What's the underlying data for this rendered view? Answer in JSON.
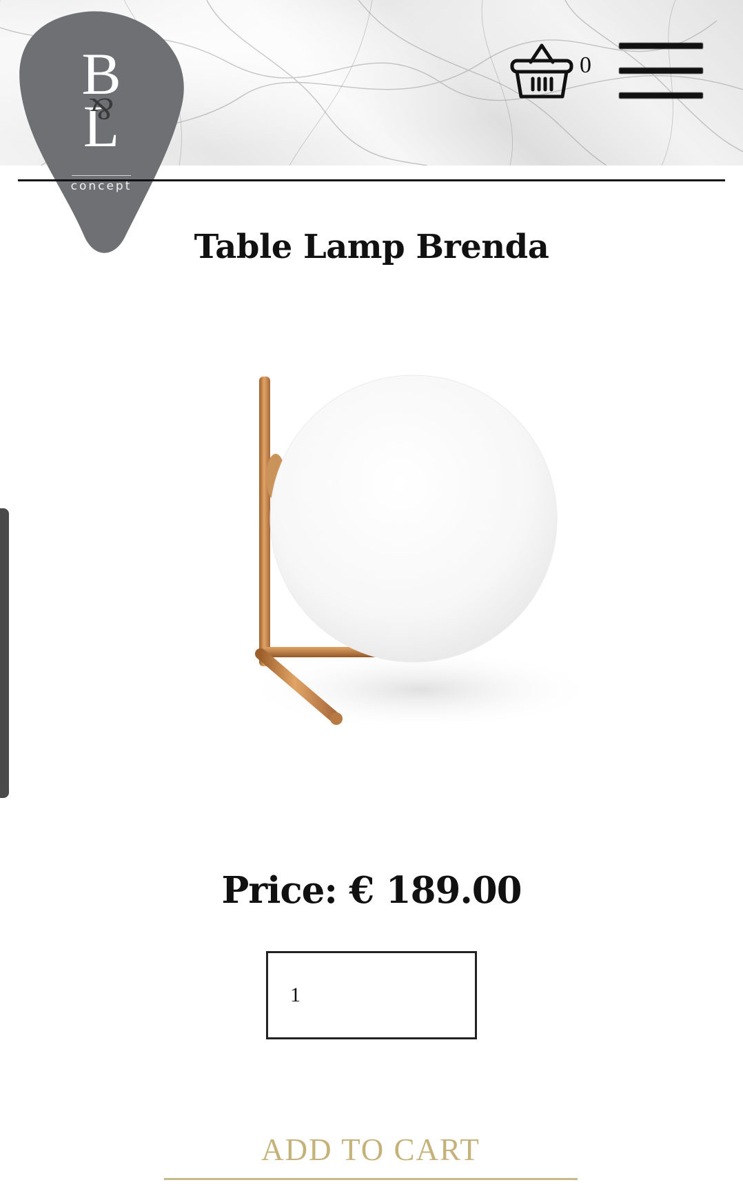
{
  "header": {
    "logo": {
      "letters": [
        "B",
        "L"
      ],
      "amp": "&",
      "subtitle": "concept",
      "color": "#6e7074"
    },
    "cart": {
      "icon": "basket-icon",
      "count": "0"
    },
    "menu": {
      "icon": "hamburger-menu-icon"
    }
  },
  "product": {
    "title": "Table Lamp Brenda",
    "image": "lamp-image",
    "price_label": "Price:",
    "price_value": "€ 189.00",
    "quantity": "1"
  },
  "actions": {
    "add_to_cart": "ADD TO CART"
  },
  "colors": {
    "accent_gold": "#c5b27a",
    "text": "#111111",
    "logo_grey": "#6e7074",
    "brass": "#c68a4a"
  }
}
